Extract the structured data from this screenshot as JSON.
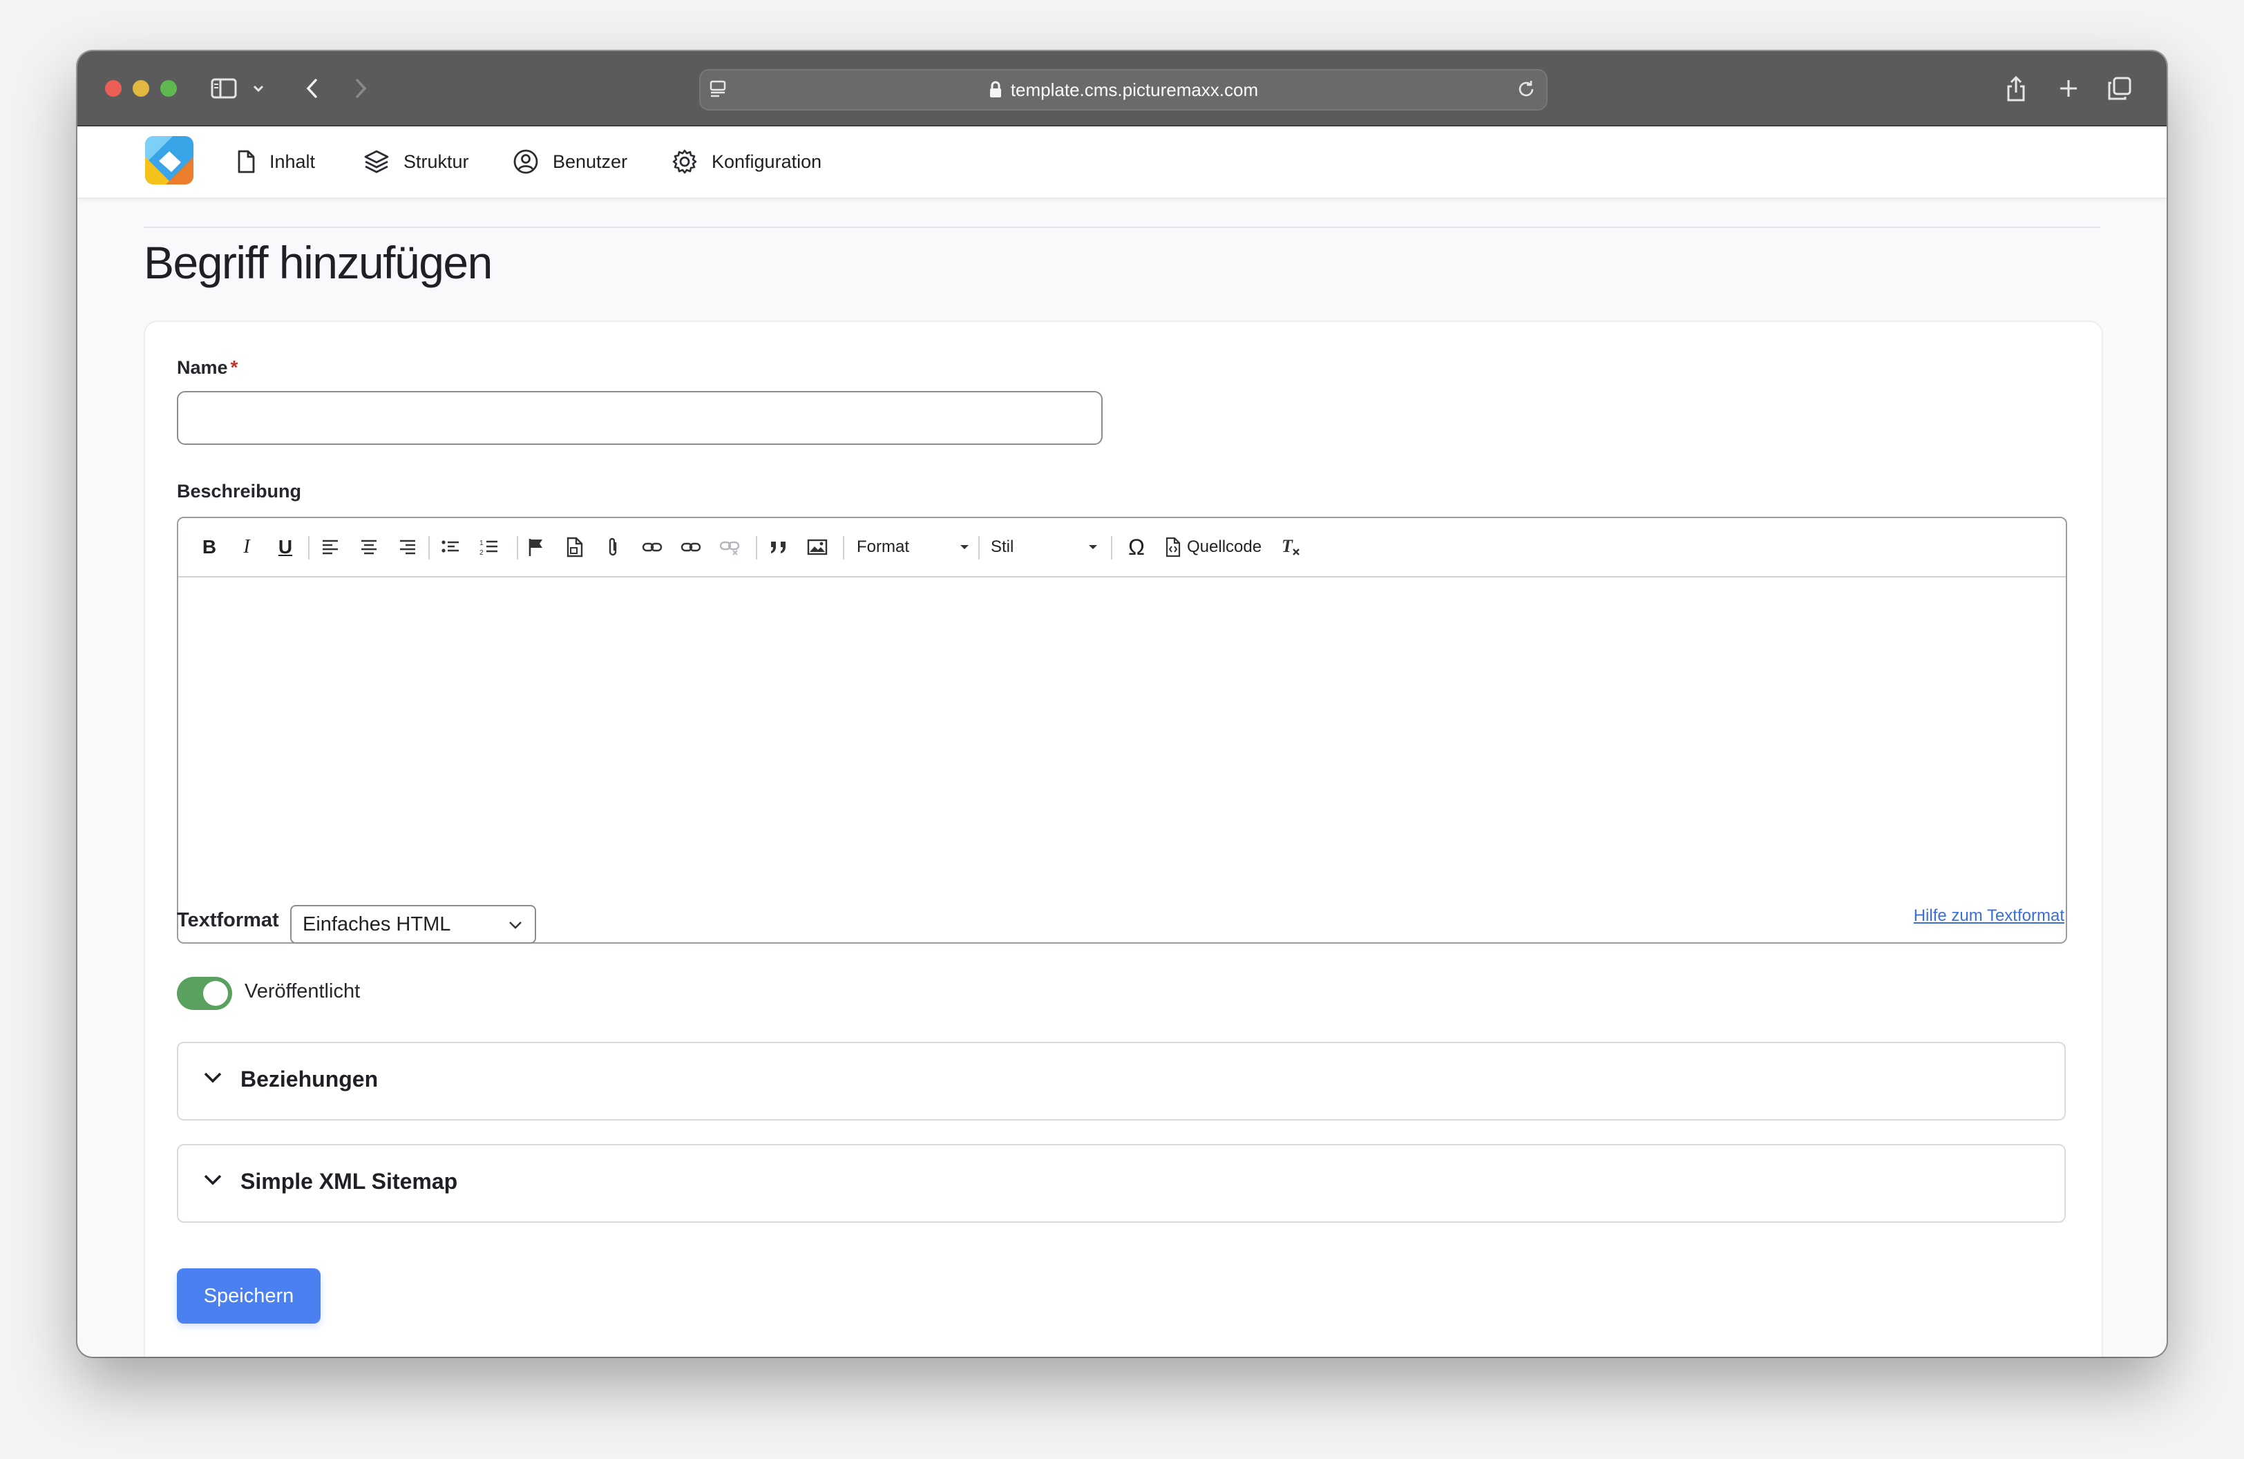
{
  "browser": {
    "url": "template.cms.picturemaxx.com"
  },
  "nav": {
    "items": [
      {
        "label": "Inhalt",
        "icon": "document-icon"
      },
      {
        "label": "Struktur",
        "icon": "layers-icon"
      },
      {
        "label": "Benutzer",
        "icon": "user-circle-icon"
      },
      {
        "label": "Konfiguration",
        "icon": "gear-icon"
      }
    ]
  },
  "page": {
    "title": "Begriff hinzufügen"
  },
  "form": {
    "name_label": "Name",
    "required_marker": "*",
    "name_value": "",
    "description_label": "Beschreibung",
    "editor": {
      "format_label": "Format",
      "style_label": "Stil",
      "source_label": "Quellcode",
      "content": ""
    },
    "textformat_label": "Textformat",
    "textformat_value": "Einfaches HTML",
    "textformat_help": "Hilfe zum Textformat",
    "published_label": "Veröffentlicht",
    "published": true,
    "sections": [
      {
        "title": "Beziehungen"
      },
      {
        "title": "Simple XML Sitemap"
      }
    ],
    "save_label": "Speichern"
  },
  "colors": {
    "primary": "#4a80f0",
    "toggle_on": "#5aa05f",
    "link": "#3b6fd8",
    "required": "#c0352b"
  }
}
